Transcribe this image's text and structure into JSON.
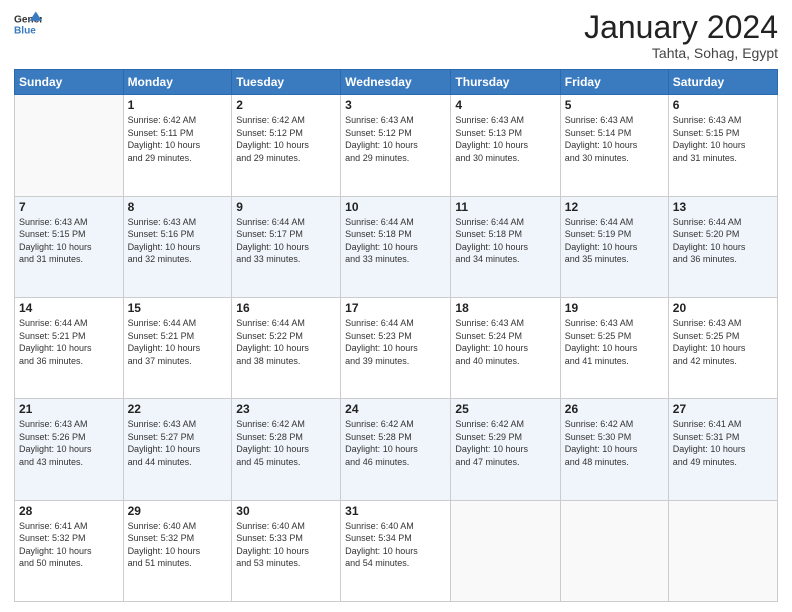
{
  "header": {
    "logo_line1": "General",
    "logo_line2": "Blue",
    "month": "January 2024",
    "location": "Tahta, Sohag, Egypt"
  },
  "weekdays": [
    "Sunday",
    "Monday",
    "Tuesday",
    "Wednesday",
    "Thursday",
    "Friday",
    "Saturday"
  ],
  "weeks": [
    [
      {
        "day": "",
        "info": ""
      },
      {
        "day": "1",
        "info": "Sunrise: 6:42 AM\nSunset: 5:11 PM\nDaylight: 10 hours\nand 29 minutes."
      },
      {
        "day": "2",
        "info": "Sunrise: 6:42 AM\nSunset: 5:12 PM\nDaylight: 10 hours\nand 29 minutes."
      },
      {
        "day": "3",
        "info": "Sunrise: 6:43 AM\nSunset: 5:12 PM\nDaylight: 10 hours\nand 29 minutes."
      },
      {
        "day": "4",
        "info": "Sunrise: 6:43 AM\nSunset: 5:13 PM\nDaylight: 10 hours\nand 30 minutes."
      },
      {
        "day": "5",
        "info": "Sunrise: 6:43 AM\nSunset: 5:14 PM\nDaylight: 10 hours\nand 30 minutes."
      },
      {
        "day": "6",
        "info": "Sunrise: 6:43 AM\nSunset: 5:15 PM\nDaylight: 10 hours\nand 31 minutes."
      }
    ],
    [
      {
        "day": "7",
        "info": "Sunrise: 6:43 AM\nSunset: 5:15 PM\nDaylight: 10 hours\nand 31 minutes."
      },
      {
        "day": "8",
        "info": "Sunrise: 6:43 AM\nSunset: 5:16 PM\nDaylight: 10 hours\nand 32 minutes."
      },
      {
        "day": "9",
        "info": "Sunrise: 6:44 AM\nSunset: 5:17 PM\nDaylight: 10 hours\nand 33 minutes."
      },
      {
        "day": "10",
        "info": "Sunrise: 6:44 AM\nSunset: 5:18 PM\nDaylight: 10 hours\nand 33 minutes."
      },
      {
        "day": "11",
        "info": "Sunrise: 6:44 AM\nSunset: 5:18 PM\nDaylight: 10 hours\nand 34 minutes."
      },
      {
        "day": "12",
        "info": "Sunrise: 6:44 AM\nSunset: 5:19 PM\nDaylight: 10 hours\nand 35 minutes."
      },
      {
        "day": "13",
        "info": "Sunrise: 6:44 AM\nSunset: 5:20 PM\nDaylight: 10 hours\nand 36 minutes."
      }
    ],
    [
      {
        "day": "14",
        "info": "Sunrise: 6:44 AM\nSunset: 5:21 PM\nDaylight: 10 hours\nand 36 minutes."
      },
      {
        "day": "15",
        "info": "Sunrise: 6:44 AM\nSunset: 5:21 PM\nDaylight: 10 hours\nand 37 minutes."
      },
      {
        "day": "16",
        "info": "Sunrise: 6:44 AM\nSunset: 5:22 PM\nDaylight: 10 hours\nand 38 minutes."
      },
      {
        "day": "17",
        "info": "Sunrise: 6:44 AM\nSunset: 5:23 PM\nDaylight: 10 hours\nand 39 minutes."
      },
      {
        "day": "18",
        "info": "Sunrise: 6:43 AM\nSunset: 5:24 PM\nDaylight: 10 hours\nand 40 minutes."
      },
      {
        "day": "19",
        "info": "Sunrise: 6:43 AM\nSunset: 5:25 PM\nDaylight: 10 hours\nand 41 minutes."
      },
      {
        "day": "20",
        "info": "Sunrise: 6:43 AM\nSunset: 5:25 PM\nDaylight: 10 hours\nand 42 minutes."
      }
    ],
    [
      {
        "day": "21",
        "info": "Sunrise: 6:43 AM\nSunset: 5:26 PM\nDaylight: 10 hours\nand 43 minutes."
      },
      {
        "day": "22",
        "info": "Sunrise: 6:43 AM\nSunset: 5:27 PM\nDaylight: 10 hours\nand 44 minutes."
      },
      {
        "day": "23",
        "info": "Sunrise: 6:42 AM\nSunset: 5:28 PM\nDaylight: 10 hours\nand 45 minutes."
      },
      {
        "day": "24",
        "info": "Sunrise: 6:42 AM\nSunset: 5:28 PM\nDaylight: 10 hours\nand 46 minutes."
      },
      {
        "day": "25",
        "info": "Sunrise: 6:42 AM\nSunset: 5:29 PM\nDaylight: 10 hours\nand 47 minutes."
      },
      {
        "day": "26",
        "info": "Sunrise: 6:42 AM\nSunset: 5:30 PM\nDaylight: 10 hours\nand 48 minutes."
      },
      {
        "day": "27",
        "info": "Sunrise: 6:41 AM\nSunset: 5:31 PM\nDaylight: 10 hours\nand 49 minutes."
      }
    ],
    [
      {
        "day": "28",
        "info": "Sunrise: 6:41 AM\nSunset: 5:32 PM\nDaylight: 10 hours\nand 50 minutes."
      },
      {
        "day": "29",
        "info": "Sunrise: 6:40 AM\nSunset: 5:32 PM\nDaylight: 10 hours\nand 51 minutes."
      },
      {
        "day": "30",
        "info": "Sunrise: 6:40 AM\nSunset: 5:33 PM\nDaylight: 10 hours\nand 53 minutes."
      },
      {
        "day": "31",
        "info": "Sunrise: 6:40 AM\nSunset: 5:34 PM\nDaylight: 10 hours\nand 54 minutes."
      },
      {
        "day": "",
        "info": ""
      },
      {
        "day": "",
        "info": ""
      },
      {
        "day": "",
        "info": ""
      }
    ]
  ]
}
